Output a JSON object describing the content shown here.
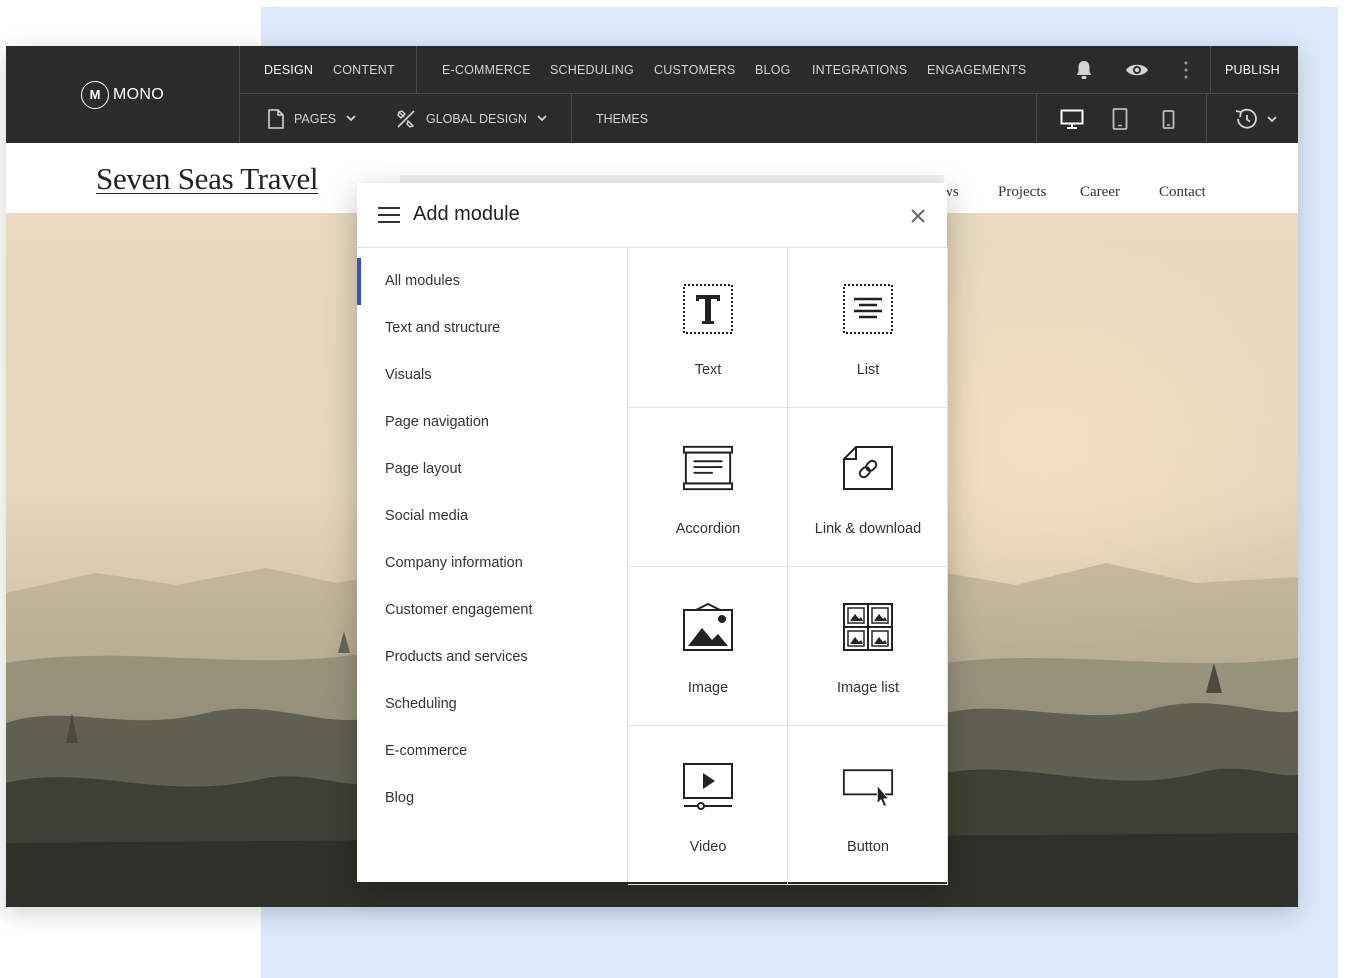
{
  "brand": {
    "logo_mark": "M",
    "name": "MONO"
  },
  "topnav": {
    "tabs": [
      "DESIGN",
      "CONTENT",
      "E-COMMERCE",
      "SCHEDULING",
      "CUSTOMERS",
      "BLOG",
      "INTEGRATIONS",
      "ENGAGEMENTS"
    ],
    "active_tab": "DESIGN",
    "publish_label": "PUBLISH",
    "icons": [
      "bell-icon",
      "eye-icon",
      "more-vertical-icon"
    ]
  },
  "toolbar": {
    "pages_label": "PAGES",
    "global_design_label": "GLOBAL DESIGN",
    "themes_label": "THEMES",
    "device_icons": [
      "desktop-icon",
      "tablet-icon",
      "mobile-icon"
    ],
    "history_icon": "history-icon"
  },
  "site": {
    "title": "Seven Seas Travel",
    "nav": [
      "ws",
      "Projects",
      "Career",
      "Contact"
    ]
  },
  "modal": {
    "title": "Add module",
    "categories": [
      "All modules",
      "Text and structure",
      "Visuals",
      "Page navigation",
      "Page layout",
      "Social media",
      "Company information",
      "Customer engagement",
      "Products and services",
      "Scheduling",
      "E-commerce",
      "Blog"
    ],
    "active_category": "All modules",
    "modules": [
      {
        "label": "Text",
        "icon": "text-module-icon"
      },
      {
        "label": "List",
        "icon": "list-module-icon"
      },
      {
        "label": "Accordion",
        "icon": "accordion-module-icon"
      },
      {
        "label": "Link & download",
        "icon": "link-download-module-icon"
      },
      {
        "label": "Image",
        "icon": "image-module-icon"
      },
      {
        "label": "Image list",
        "icon": "image-list-module-icon"
      },
      {
        "label": "Video",
        "icon": "video-module-icon"
      },
      {
        "label": "Button",
        "icon": "button-module-icon"
      }
    ]
  },
  "colors": {
    "topbar": "#2b2b2b",
    "accent": "#3a4fc4",
    "backdrop": "#dbe9fb"
  }
}
